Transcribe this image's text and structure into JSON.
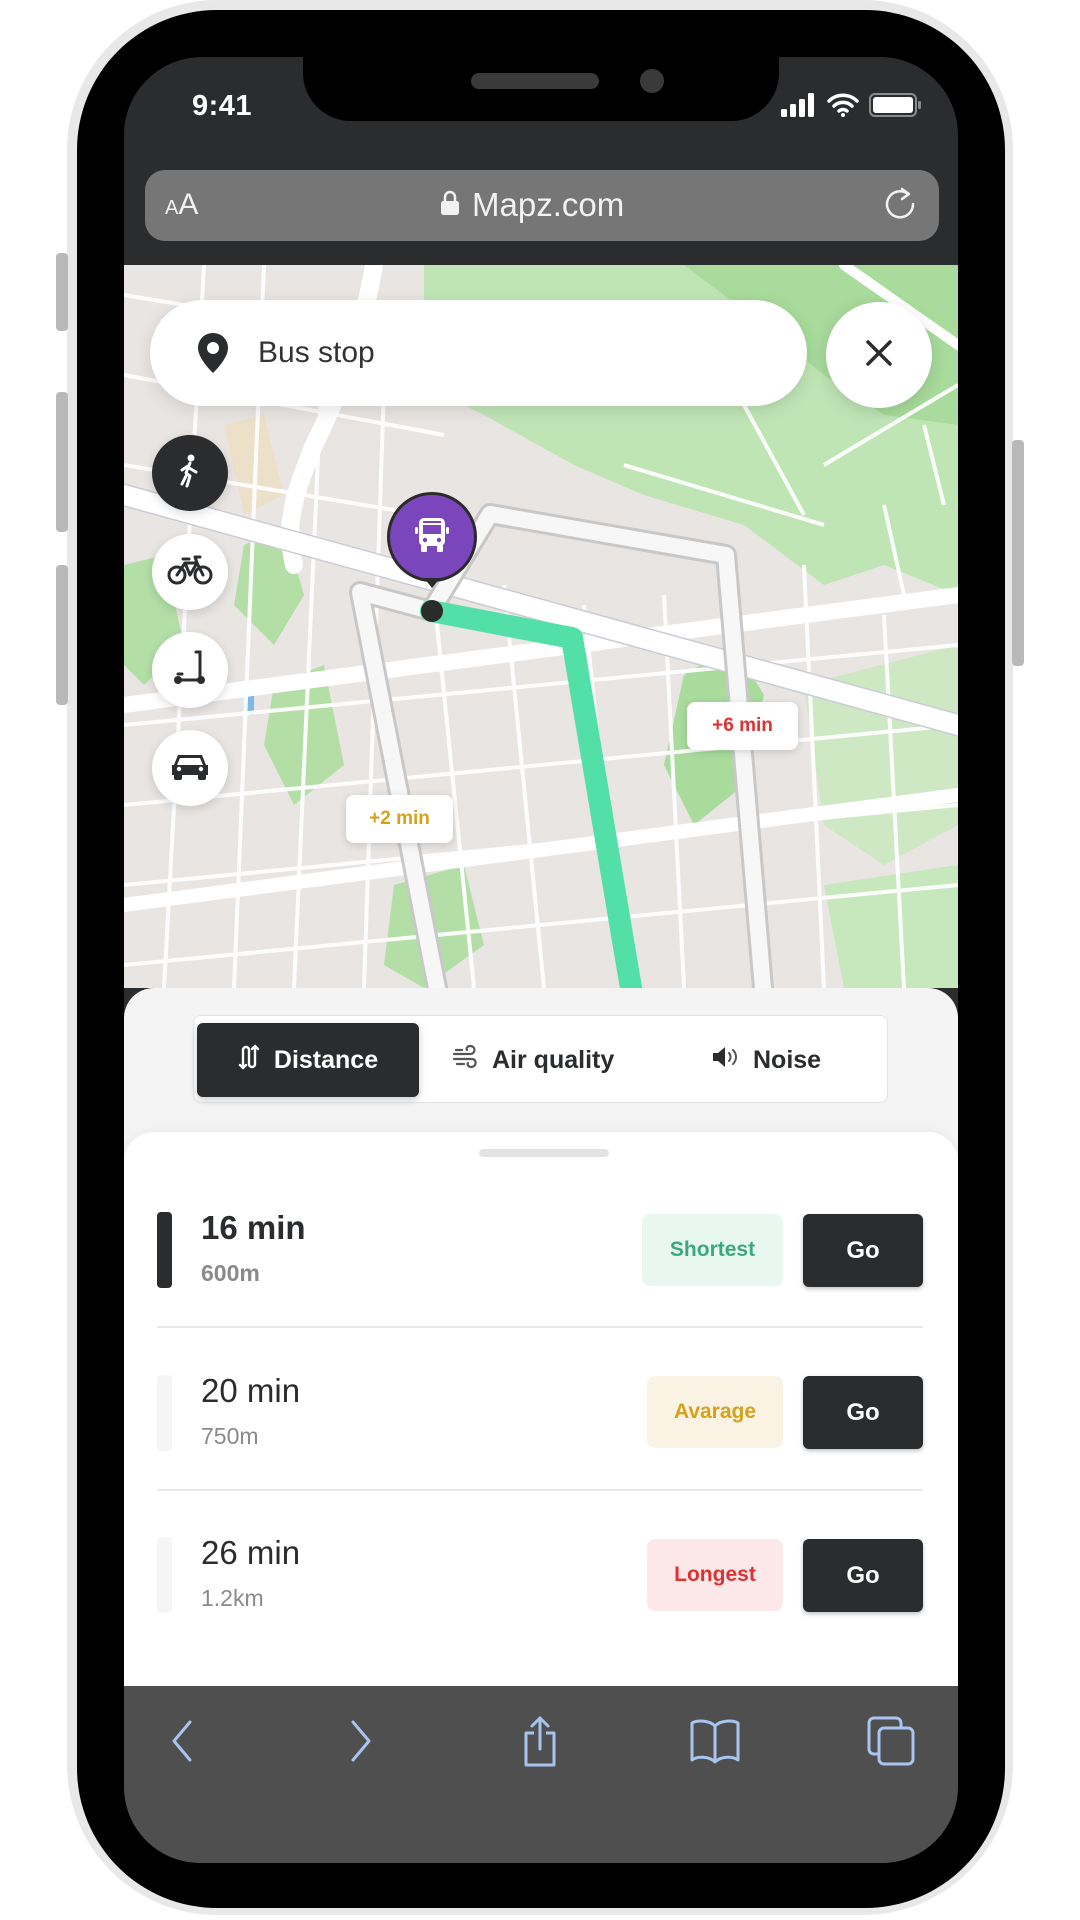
{
  "status_bar": {
    "time": "9:41",
    "icons": [
      "signal-icon",
      "wifi-icon",
      "battery-icon"
    ]
  },
  "browser": {
    "text_size_label_small": "A",
    "text_size_label_large": "A",
    "url": "Mapz.com",
    "lock_icon": "lock-icon",
    "reload_icon": "reload-icon"
  },
  "map": {
    "search": {
      "value": "Bus stop",
      "icon": "location-pin-icon"
    },
    "close_icon": "close-icon",
    "transport_modes": [
      {
        "name": "walk",
        "icon": "walk-icon",
        "active": true
      },
      {
        "name": "bike",
        "icon": "bike-icon",
        "active": false
      },
      {
        "name": "scooter",
        "icon": "scooter-icon",
        "active": false
      },
      {
        "name": "car",
        "icon": "car-icon",
        "active": false
      }
    ],
    "destination_marker_icon": "bus-icon",
    "route_tags": [
      {
        "label": "+2 min",
        "color": "#D4A21C"
      },
      {
        "label": "+6 min",
        "color": "#E03131"
      }
    ],
    "route_color": "#52E0A8",
    "marker_color": "#7B45BB"
  },
  "sort_tabs": [
    {
      "label": "Distance",
      "icon": "distance-icon",
      "active": true
    },
    {
      "label": "Air quality",
      "icon": "wind-icon",
      "active": false
    },
    {
      "label": "Noise",
      "icon": "speaker-icon",
      "active": false
    }
  ],
  "routes": [
    {
      "time": "16 min",
      "distance": "600m",
      "badge": "Shortest",
      "badge_color": "#3BAA7A",
      "badge_bg": "#E9F7F1",
      "action": "Go",
      "selected": true
    },
    {
      "time": "20 min",
      "distance": "750m",
      "badge": "Avarage",
      "badge_color": "#D4A21C",
      "badge_bg": "#FAF3E3",
      "action": "Go",
      "selected": false
    },
    {
      "time": "26 min",
      "distance": "1.2km",
      "badge": "Longest",
      "badge_color": "#E03131",
      "badge_bg": "#FCE8E9",
      "action": "Go",
      "selected": false
    }
  ],
  "safari_toolbar": [
    "back-icon",
    "forward-icon",
    "share-icon",
    "bookmarks-icon",
    "tabs-icon"
  ]
}
